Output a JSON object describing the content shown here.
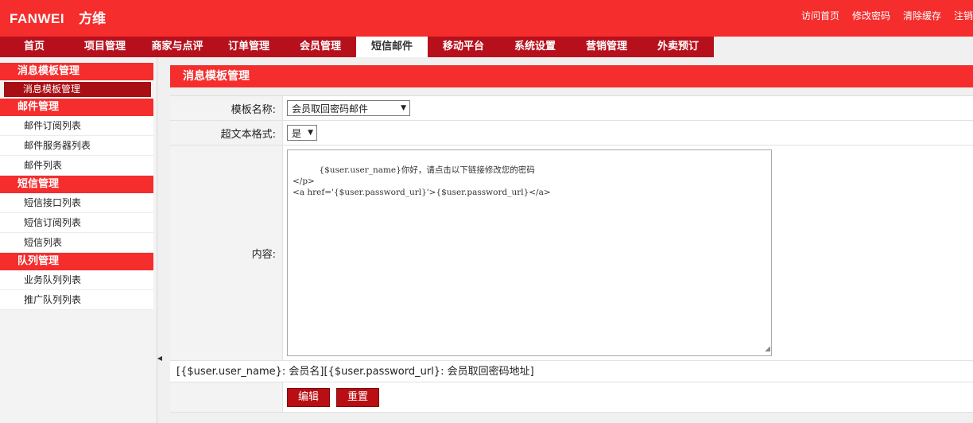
{
  "header": {
    "logo_en": "FANWEI",
    "logo_cn": "方维",
    "links": [
      "访问首页",
      "修改密码",
      "清除缓存",
      "注销"
    ]
  },
  "nav": {
    "items": [
      "首页",
      "项目管理",
      "商家与点评",
      "订单管理",
      "会员管理",
      "短信邮件",
      "移动平台",
      "系统设置",
      "营销管理",
      "外卖预订"
    ],
    "active_index": 5
  },
  "sidebar": {
    "sections": [
      {
        "title": "消息模板管理",
        "items": [
          "消息模板管理"
        ]
      },
      {
        "title": "邮件管理",
        "items": [
          "邮件订阅列表",
          "邮件服务器列表",
          "邮件列表"
        ]
      },
      {
        "title": "短信管理",
        "items": [
          "短信接口列表",
          "短信订阅列表",
          "短信列表"
        ]
      },
      {
        "title": "队列管理",
        "items": [
          "业务队列列表",
          "推广队列列表"
        ]
      }
    ]
  },
  "main": {
    "title": "消息模板管理",
    "template_label": "模板名称:",
    "template_value": "会员取回密码邮件",
    "rich_label": "超文本格式:",
    "rich_value": "是",
    "content_label": "内容:",
    "content_value": "{$user.user_name}你好，请点击以下链接修改您的密码\n</p>\n<a href='{$user.password_url}'>{$user.password_url}</a>",
    "hint": "[{$user.user_name}: 会员名][{$user.password_url}: 会员取回密码地址]",
    "edit_button": "编辑",
    "reset_button": "重置"
  },
  "colors": {
    "brand_red": "#f52d2d",
    "dark_red": "#b7101d"
  }
}
